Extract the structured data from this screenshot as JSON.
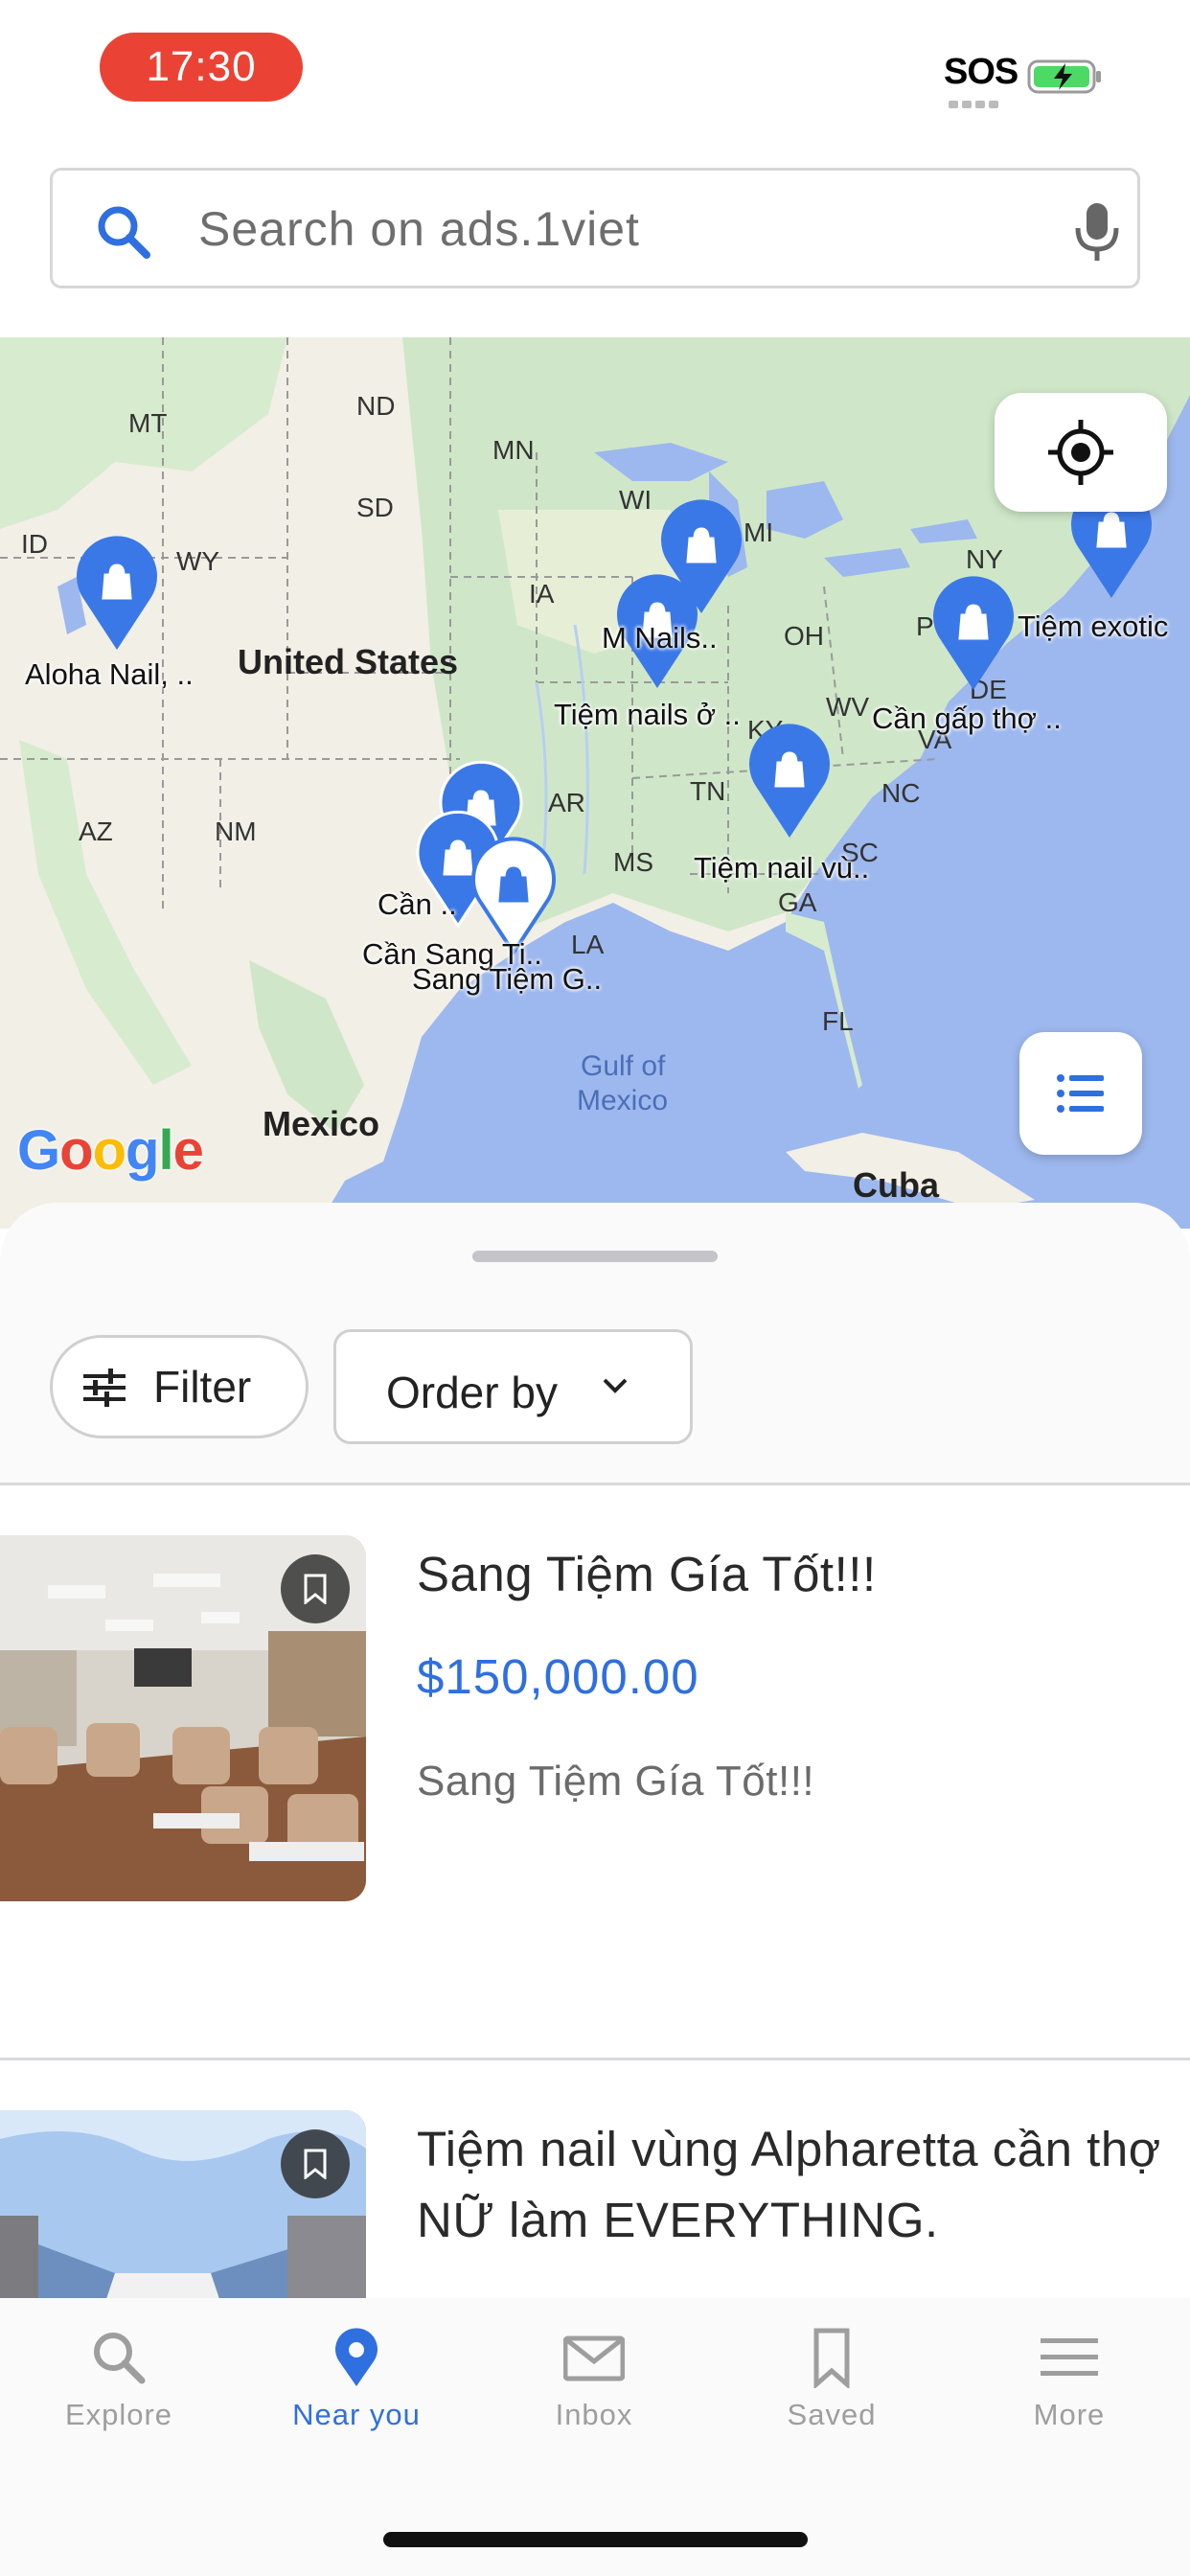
{
  "status_bar": {
    "time": "17:30",
    "sos": "SOS"
  },
  "search": {
    "placeholder": "Search on ads.1viet"
  },
  "map": {
    "labels": {
      "mt": "MT",
      "nd": "ND",
      "mn": "MN",
      "sd": "SD",
      "wy": "WY",
      "id": "ID",
      "wi": "WI",
      "mi": "MI",
      "ia": "IA",
      "oh": "OH",
      "ny": "NY",
      "wv": "WV",
      "va": "VA",
      "de": "DE",
      "ky": "KY",
      "tn": "TN",
      "nc": "NC",
      "ar": "AR",
      "ms": "MS",
      "sc": "SC",
      "ga": "GA",
      "la": "LA",
      "az": "AZ",
      "nm": "NM",
      "fl": "FL",
      "pa": "P",
      "us": "United States",
      "mexico": "Mexico",
      "cuba": "Cuba",
      "gulf": "Gulf of",
      "gulf2": "Mexico"
    },
    "pin_labels": [
      "Aloha Nail, ..",
      "M Nails..",
      "Tiệm nails ở ..",
      "Tiệm exotic",
      "Cần gấp thợ ..",
      "Tiệm nail vù..",
      "Cần ..",
      "Cần Sang Ti..",
      "Sang Tiệm G.."
    ],
    "google": "Google"
  },
  "filter": {
    "filter_label": "Filter",
    "order_label": "Order by"
  },
  "listings": [
    {
      "title": "Sang Tiệm Gía Tốt!!!",
      "price": "$150,000.00",
      "description": "Sang Tiệm Gía Tốt!!!"
    },
    {
      "title": "Tiệm nail vùng Alpharetta cần thợ NỮ làm EVERYTHING."
    }
  ],
  "nav": [
    {
      "label": "Explore",
      "icon": "search-icon",
      "active": false
    },
    {
      "label": "Near you",
      "icon": "location-pin-icon",
      "active": true
    },
    {
      "label": "Inbox",
      "icon": "mail-icon",
      "active": false
    },
    {
      "label": "Saved",
      "icon": "bookmark-icon",
      "active": false
    },
    {
      "label": "More",
      "icon": "menu-icon",
      "active": false
    }
  ],
  "colors": {
    "accent": "#2f6fe0",
    "time_pill": "#ea4335",
    "pin": "#3b78e7",
    "water": "#9db8ee",
    "land": "#f2efe6",
    "green": "#cfe7c8"
  }
}
